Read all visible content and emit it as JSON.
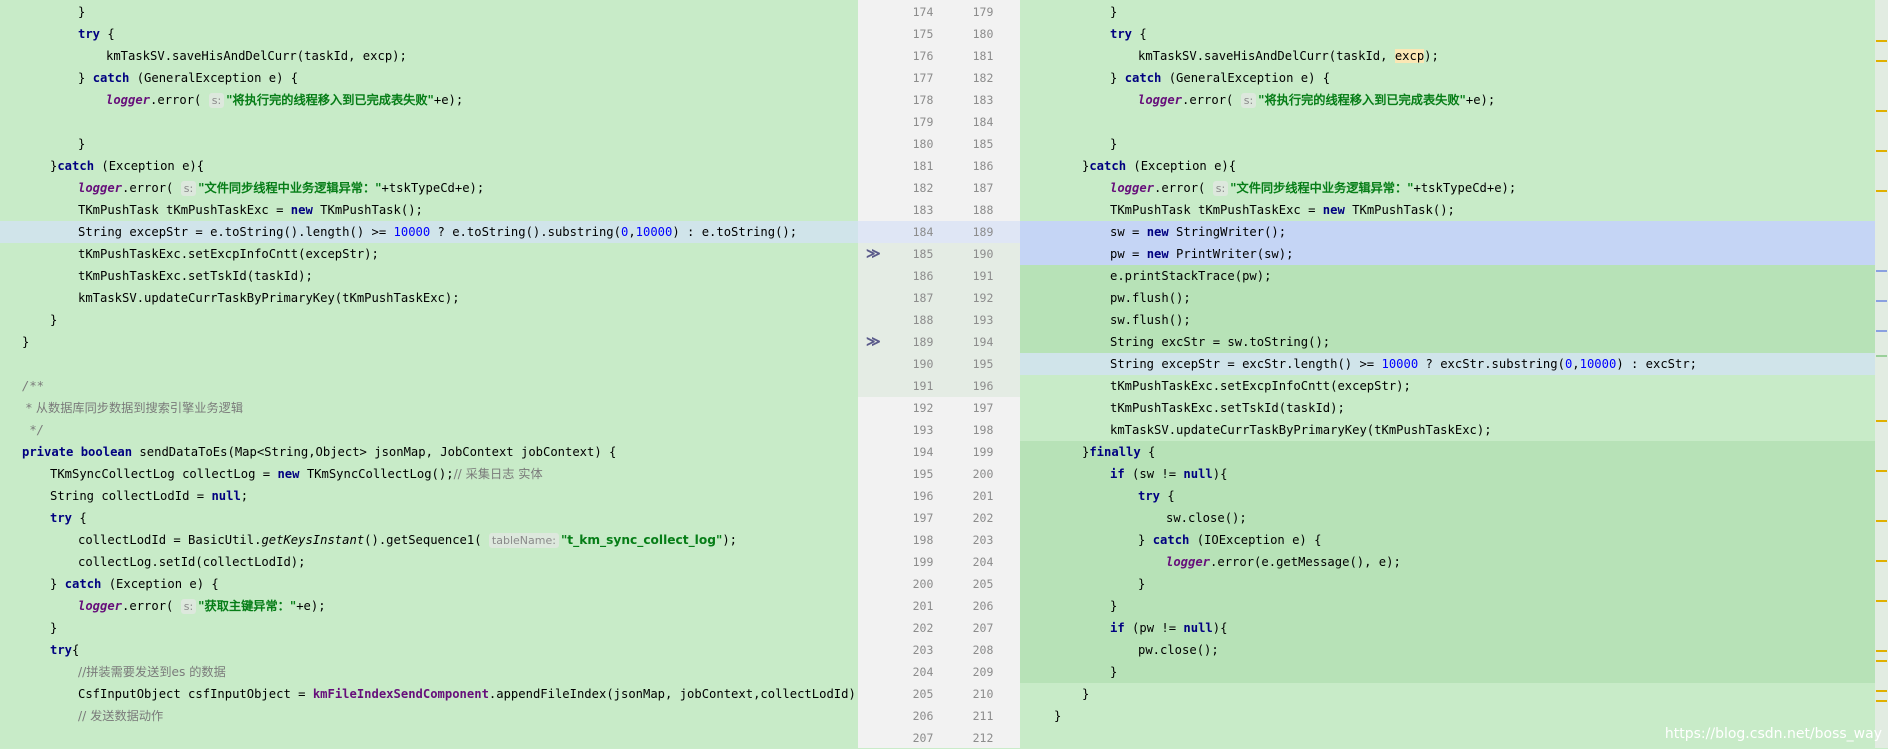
{
  "left_lines": [
    {
      "ln": "174",
      "indent": 3,
      "parts": [
        {
          "t": "}"
        }
      ]
    },
    {
      "ln": "175",
      "indent": 3,
      "parts": [
        {
          "t": "try",
          "c": "kw"
        },
        {
          "t": " {"
        }
      ]
    },
    {
      "ln": "176",
      "indent": 4,
      "parts": [
        {
          "t": "kmTaskSV.saveHisAndDelCurr(taskId, excp);"
        }
      ]
    },
    {
      "ln": "177",
      "indent": 3,
      "parts": [
        {
          "t": "} "
        },
        {
          "t": "catch",
          "c": "kw"
        },
        {
          "t": " (GeneralException e) {"
        }
      ]
    },
    {
      "ln": "178",
      "indent": 4,
      "parts": [
        {
          "t": "logger",
          "c": "fld"
        },
        {
          "t": ".error( "
        },
        {
          "t": "s:",
          "c": "hint"
        },
        {
          "t": "\"将执行完的线程移入到已完成表失败\"",
          "c": "str"
        },
        {
          "t": "+e);"
        }
      ]
    },
    {
      "ln": "179",
      "indent": 0,
      "parts": [
        {
          "t": ""
        }
      ]
    },
    {
      "ln": "180",
      "indent": 3,
      "parts": [
        {
          "t": "}"
        }
      ]
    },
    {
      "ln": "181",
      "indent": 2,
      "parts": [
        {
          "t": "}"
        },
        {
          "t": "catch",
          "c": "kw"
        },
        {
          "t": " (Exception e){"
        }
      ]
    },
    {
      "ln": "182",
      "indent": 3,
      "parts": [
        {
          "t": "logger",
          "c": "fld"
        },
        {
          "t": ".error( "
        },
        {
          "t": "s:",
          "c": "hint"
        },
        {
          "t": "\"文件同步线程中业务逻辑异常：\"",
          "c": "str"
        },
        {
          "t": "+tskTypeCd+e);"
        }
      ]
    },
    {
      "ln": "183",
      "indent": 3,
      "parts": [
        {
          "t": "TKmPushTask tKmPushTaskExc = "
        },
        {
          "t": "new",
          "c": "kw"
        },
        {
          "t": " TKmPushTask();"
        }
      ]
    },
    {
      "ln": "184",
      "indent": 3,
      "bg": "sel-light",
      "parts": [
        {
          "t": "String excepStr = e.toString().length() >= "
        },
        {
          "t": "10000",
          "c": "num"
        },
        {
          "t": " ? e.toString().substring("
        },
        {
          "t": "0",
          "c": "num"
        },
        {
          "t": ","
        },
        {
          "t": "10000",
          "c": "num"
        },
        {
          "t": ") : e.toString();"
        }
      ]
    },
    {
      "ln": "185",
      "indent": 3,
      "parts": [
        {
          "t": "tKmPushTaskExc.setExcpInfoCntt(excepStr);"
        }
      ]
    },
    {
      "ln": "186",
      "indent": 3,
      "parts": [
        {
          "t": "tKmPushTaskExc.setTskId(taskId);"
        }
      ]
    },
    {
      "ln": "187",
      "indent": 3,
      "parts": [
        {
          "t": "kmTaskSV.updateCurrTaskByPrimaryKey(tKmPushTaskExc);"
        }
      ]
    },
    {
      "ln": "188",
      "indent": 2,
      "parts": [
        {
          "t": "}"
        }
      ]
    },
    {
      "ln": "189",
      "indent": 1,
      "parts": [
        {
          "t": "}"
        }
      ]
    },
    {
      "ln": "190",
      "indent": 0,
      "parts": [
        {
          "t": ""
        }
      ]
    },
    {
      "ln": "191",
      "indent": 1,
      "parts": [
        {
          "t": "/**",
          "c": "cmt"
        }
      ]
    },
    {
      "ln": "192",
      "indent": 1,
      "parts": [
        {
          "t": " * 从数据库同步数据到搜索引擎业务逻辑",
          "c": "cmtcn"
        }
      ]
    },
    {
      "ln": "193",
      "indent": 1,
      "parts": [
        {
          "t": " */",
          "c": "cmt"
        }
      ]
    },
    {
      "ln": "194",
      "indent": 1,
      "parts": [
        {
          "t": "private",
          "c": "kw"
        },
        {
          "t": " "
        },
        {
          "t": "boolean",
          "c": "kw"
        },
        {
          "t": " sendDataToEs(Map<String,Object> jsonMap, JobContext jobContext) {"
        }
      ]
    },
    {
      "ln": "195",
      "indent": 2,
      "parts": [
        {
          "t": "TKmSyncCollectLog collectLog = "
        },
        {
          "t": "new",
          "c": "kw"
        },
        {
          "t": " TKmSyncCollectLog();"
        },
        {
          "t": "// 采集日志 实体",
          "c": "cmtcn"
        }
      ]
    },
    {
      "ln": "196",
      "indent": 2,
      "parts": [
        {
          "t": "String collectLodId = "
        },
        {
          "t": "null",
          "c": "kw"
        },
        {
          "t": ";"
        }
      ]
    },
    {
      "ln": "197",
      "indent": 2,
      "parts": [
        {
          "t": "try",
          "c": "kw"
        },
        {
          "t": " {"
        }
      ]
    },
    {
      "ln": "198",
      "indent": 3,
      "parts": [
        {
          "t": "collectLodId = BasicUtil."
        },
        {
          "t": "getKeysInstant",
          "c": "meth"
        },
        {
          "t": "().getSequence1( "
        },
        {
          "t": "tableName:",
          "c": "hint"
        },
        {
          "t": "\"t_km_sync_collect_log\"",
          "c": "str"
        },
        {
          "t": ");"
        }
      ]
    },
    {
      "ln": "199",
      "indent": 3,
      "parts": [
        {
          "t": "collectLog.setId(collectLodId);"
        }
      ]
    },
    {
      "ln": "200",
      "indent": 2,
      "parts": [
        {
          "t": "} "
        },
        {
          "t": "catch",
          "c": "kw"
        },
        {
          "t": " (Exception e) {"
        }
      ]
    },
    {
      "ln": "201",
      "indent": 3,
      "parts": [
        {
          "t": "logger",
          "c": "fld"
        },
        {
          "t": ".error( "
        },
        {
          "t": "s:",
          "c": "hint"
        },
        {
          "t": "\"获取主键异常：\"",
          "c": "str"
        },
        {
          "t": "+e);"
        }
      ]
    },
    {
      "ln": "202",
      "indent": 2,
      "parts": [
        {
          "t": "}"
        }
      ]
    },
    {
      "ln": "203",
      "indent": 2,
      "parts": [
        {
          "t": "try",
          "c": "kw"
        },
        {
          "t": "{"
        }
      ]
    },
    {
      "ln": "204",
      "indent": 3,
      "parts": [
        {
          "t": "//拼装需要发送到es 的数据",
          "c": "cmtcn"
        }
      ]
    },
    {
      "ln": "205",
      "indent": 3,
      "parts": [
        {
          "t": "CsfInputObject csfInputObject = "
        },
        {
          "t": "kmFileIndexSendComponent",
          "c": "sfld"
        },
        {
          "t": ".appendFileIndex(jsonMap, jobContext,collectLodId);"
        }
      ]
    },
    {
      "ln": "206",
      "indent": 3,
      "parts": [
        {
          "t": "// 发送数据动作",
          "c": "cmtcn"
        }
      ]
    }
  ],
  "right_lines": [
    {
      "ln": "179",
      "indent": 3,
      "parts": [
        {
          "t": "}"
        }
      ]
    },
    {
      "ln": "180",
      "indent": 3,
      "parts": [
        {
          "t": "try",
          "c": "kw"
        },
        {
          "t": " {"
        }
      ]
    },
    {
      "ln": "181",
      "indent": 4,
      "parts": [
        {
          "t": "kmTaskSV.saveHisAndDelCurr(taskId, "
        },
        {
          "t": "excp",
          "c": "hl"
        },
        {
          "t": ");"
        }
      ]
    },
    {
      "ln": "182",
      "indent": 3,
      "parts": [
        {
          "t": "} "
        },
        {
          "t": "catch",
          "c": "kw"
        },
        {
          "t": " (GeneralException e) {"
        }
      ]
    },
    {
      "ln": "183",
      "indent": 4,
      "parts": [
        {
          "t": "logger",
          "c": "fld"
        },
        {
          "t": ".error( "
        },
        {
          "t": "s:",
          "c": "hint"
        },
        {
          "t": "\"将执行完的线程移入到已完成表失败\"",
          "c": "str"
        },
        {
          "t": "+e);"
        }
      ]
    },
    {
      "ln": "184",
      "indent": 0,
      "parts": [
        {
          "t": ""
        }
      ]
    },
    {
      "ln": "185",
      "indent": 3,
      "parts": [
        {
          "t": "}"
        }
      ]
    },
    {
      "ln": "186",
      "indent": 2,
      "parts": [
        {
          "t": "}"
        },
        {
          "t": "catch",
          "c": "kw"
        },
        {
          "t": " (Exception e){"
        }
      ]
    },
    {
      "ln": "187",
      "indent": 3,
      "parts": [
        {
          "t": "logger",
          "c": "fld"
        },
        {
          "t": ".error( "
        },
        {
          "t": "s:",
          "c": "hint"
        },
        {
          "t": "\"文件同步线程中业务逻辑异常：\"",
          "c": "str"
        },
        {
          "t": "+tskTypeCd+e);"
        }
      ]
    },
    {
      "ln": "188",
      "indent": 3,
      "parts": [
        {
          "t": "TKmPushTask tKmPushTaskExc = "
        },
        {
          "t": "new",
          "c": "kw"
        },
        {
          "t": " TKmPushTask();"
        }
      ]
    },
    {
      "ln": "189",
      "indent": 3,
      "bg": "sel-blue",
      "parts": [
        {
          "t": "sw = "
        },
        {
          "t": "new",
          "c": "kw"
        },
        {
          "t": " StringWriter();"
        }
      ]
    },
    {
      "ln": "190",
      "indent": 3,
      "bg": "sel-blue",
      "parts": [
        {
          "t": "pw = "
        },
        {
          "t": "new",
          "c": "kw"
        },
        {
          "t": " PrintWriter(sw);"
        }
      ]
    },
    {
      "ln": "191",
      "indent": 3,
      "bg": "chg-green",
      "parts": [
        {
          "t": "e.printStackTrace(pw);"
        }
      ]
    },
    {
      "ln": "192",
      "indent": 3,
      "bg": "chg-green",
      "parts": [
        {
          "t": "pw.flush();"
        }
      ]
    },
    {
      "ln": "193",
      "indent": 3,
      "bg": "chg-green",
      "parts": [
        {
          "t": "sw.flush();"
        }
      ]
    },
    {
      "ln": "194",
      "indent": 3,
      "bg": "chg-green",
      "parts": [
        {
          "t": "String excStr = sw.toString();"
        }
      ]
    },
    {
      "ln": "195",
      "indent": 3,
      "bg": "sel-light",
      "parts": [
        {
          "t": "String excepStr = excStr.length() >= "
        },
        {
          "t": "10000",
          "c": "num"
        },
        {
          "t": " ? excStr.substring("
        },
        {
          "t": "0",
          "c": "num"
        },
        {
          "t": ","
        },
        {
          "t": "10000",
          "c": "num"
        },
        {
          "t": ") : excStr;"
        }
      ]
    },
    {
      "ln": "196",
      "indent": 3,
      "parts": [
        {
          "t": "tKmPushTaskExc.setExcpInfoCntt(excepStr);"
        }
      ]
    },
    {
      "ln": "197",
      "indent": 3,
      "parts": [
        {
          "t": "tKmPushTaskExc.setTskId(taskId);"
        }
      ]
    },
    {
      "ln": "198",
      "indent": 3,
      "parts": [
        {
          "t": "kmTaskSV.updateCurrTaskByPrimaryKey(tKmPushTaskExc);"
        }
      ]
    },
    {
      "ln": "199",
      "indent": 2,
      "bg": "chg-green",
      "parts": [
        {
          "t": "}"
        },
        {
          "t": "finally",
          "c": "kw"
        },
        {
          "t": " {"
        }
      ]
    },
    {
      "ln": "200",
      "indent": 3,
      "bg": "chg-green",
      "parts": [
        {
          "t": "if",
          "c": "kw"
        },
        {
          "t": " (sw != "
        },
        {
          "t": "null",
          "c": "kw"
        },
        {
          "t": "){"
        }
      ]
    },
    {
      "ln": "201",
      "indent": 4,
      "bg": "chg-green",
      "parts": [
        {
          "t": "try",
          "c": "kw"
        },
        {
          "t": " {"
        }
      ]
    },
    {
      "ln": "202",
      "indent": 5,
      "bg": "chg-green",
      "parts": [
        {
          "t": "sw.close();"
        }
      ]
    },
    {
      "ln": "203",
      "indent": 4,
      "bg": "chg-green",
      "parts": [
        {
          "t": "} "
        },
        {
          "t": "catch",
          "c": "kw"
        },
        {
          "t": " (IOException e) {"
        }
      ]
    },
    {
      "ln": "204",
      "indent": 5,
      "bg": "chg-green",
      "parts": [
        {
          "t": "logger",
          "c": "fld"
        },
        {
          "t": ".error(e.getMessage(), e);"
        }
      ]
    },
    {
      "ln": "205",
      "indent": 4,
      "bg": "chg-green",
      "parts": [
        {
          "t": "}"
        }
      ]
    },
    {
      "ln": "206",
      "indent": 3,
      "bg": "chg-green",
      "parts": [
        {
          "t": "}"
        }
      ]
    },
    {
      "ln": "207",
      "indent": 3,
      "bg": "chg-green",
      "parts": [
        {
          "t": "if",
          "c": "kw"
        },
        {
          "t": " (pw != "
        },
        {
          "t": "null",
          "c": "kw"
        },
        {
          "t": "){"
        }
      ]
    },
    {
      "ln": "208",
      "indent": 4,
      "bg": "chg-green",
      "parts": [
        {
          "t": "pw.close();"
        }
      ]
    },
    {
      "ln": "209",
      "indent": 3,
      "bg": "chg-green",
      "parts": [
        {
          "t": "}"
        }
      ]
    },
    {
      "ln": "210",
      "indent": 2,
      "parts": [
        {
          "t": "}"
        }
      ]
    },
    {
      "ln": "211",
      "indent": 1,
      "parts": [
        {
          "t": "}"
        }
      ]
    }
  ],
  "gutter": {
    "left_numbers": [
      "174",
      "175",
      "176",
      "177",
      "178",
      "179",
      "180",
      "181",
      "182",
      "183",
      "184",
      "185",
      "186",
      "187",
      "188",
      "189",
      "190",
      "191",
      "192",
      "193",
      "194",
      "195",
      "196",
      "197",
      "198",
      "199",
      "200",
      "201",
      "202",
      "203",
      "204",
      "205",
      "206",
      "207"
    ],
    "right_numbers": [
      "179",
      "180",
      "181",
      "182",
      "183",
      "184",
      "185",
      "186",
      "187",
      "188",
      "189",
      "190",
      "191",
      "192",
      "193",
      "194",
      "195",
      "196",
      "197",
      "198",
      "199",
      "200",
      "201",
      "202",
      "203",
      "204",
      "205",
      "206",
      "207",
      "208",
      "209",
      "210",
      "211",
      "212"
    ],
    "arrow_symbol": "≫",
    "arrow_rows": [
      11,
      15
    ]
  },
  "colors": {
    "pane_green": "#c8ebc8",
    "selection_blue": "#c5d5f5",
    "changed_green": "#b7e2b7",
    "keyword": "#000080",
    "string": "#067d17",
    "field": "#660e7a"
  },
  "watermark": "https://blog.csdn.net/boss_way"
}
